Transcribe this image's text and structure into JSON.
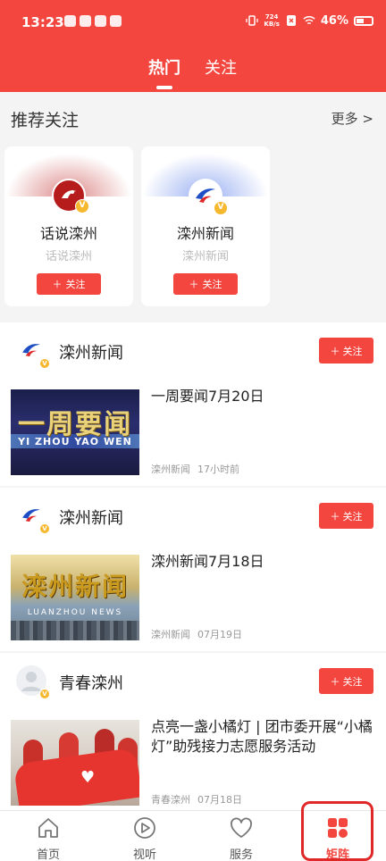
{
  "status_bar": {
    "time": "13:23",
    "net_speed_value": "724",
    "net_speed_unit": "KB/s",
    "battery": "46%"
  },
  "header": {
    "tabs": [
      {
        "label": "热门",
        "active": true
      },
      {
        "label": "关注",
        "active": false
      }
    ],
    "accent_color": "#f2463f"
  },
  "recommend": {
    "title": "推荐关注",
    "more": "更多 >",
    "cards": [
      {
        "name": "话说滦州",
        "sub": "话说滦州",
        "follow": "关注"
      },
      {
        "name": "滦州新闻",
        "sub": "滦州新闻",
        "follow": "关注"
      }
    ]
  },
  "feed": [
    {
      "account": "滦州新闻",
      "follow": "关注",
      "title": "一周要闻7月20日",
      "source": "滦州新闻",
      "time": "17小时前",
      "thumb_text": "一周要闻",
      "thumb_sub": "YI ZHOU YAO WEN"
    },
    {
      "account": "滦州新闻",
      "follow": "关注",
      "title": "滦州新闻7月18日",
      "source": "滦州新闻",
      "time": "07月19日",
      "thumb_text": "滦州新闻",
      "thumb_sub": "LUANZHOU NEWS"
    },
    {
      "account": "青春滦州",
      "follow": "关注",
      "title": "点亮一盏小橘灯 | 团市委开展“小橘灯”助残接力志愿服务活动",
      "source": "青春滦州",
      "time": "07月18日"
    }
  ],
  "bottom_nav": [
    {
      "label": "首页",
      "icon": "home-icon"
    },
    {
      "label": "视听",
      "icon": "play-icon"
    },
    {
      "label": "服务",
      "icon": "heart-icon"
    },
    {
      "label": "矩阵",
      "icon": "grid-icon",
      "active": true
    }
  ]
}
